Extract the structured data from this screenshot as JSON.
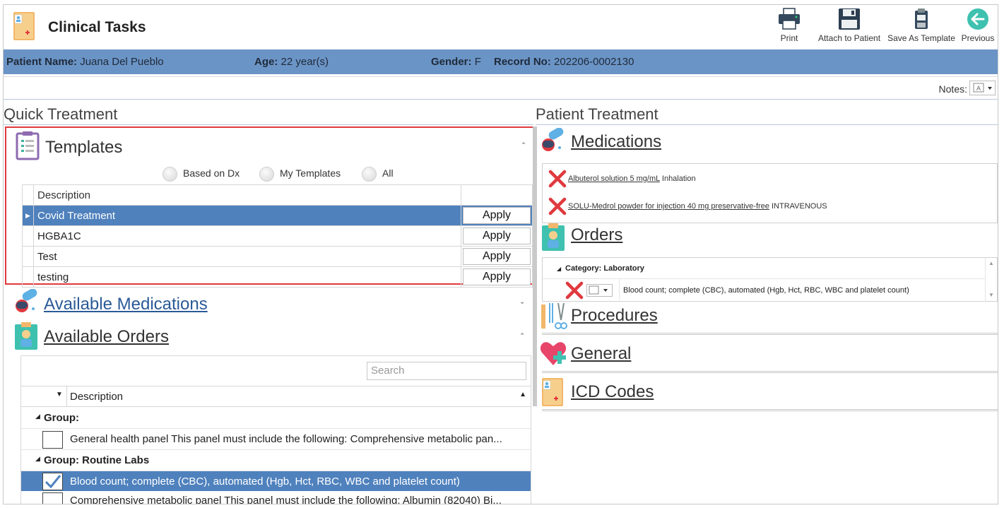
{
  "app": {
    "title": "Clinical Tasks"
  },
  "toolbar": {
    "print": "Print",
    "attach": "Attach to Patient",
    "save_template": "Save As Template",
    "previous": "Previous"
  },
  "patient": {
    "name_label": "Patient Name:",
    "name": "Juana Del Pueblo",
    "age_label": "Age:",
    "age": "22 year(s)",
    "gender_label": "Gender:",
    "gender": "F",
    "record_label": "Record No:",
    "record": "202206-0002130"
  },
  "notes": {
    "label": "Notes:"
  },
  "quick_treatment": {
    "title": "Quick Treatment",
    "templates": {
      "title": "Templates",
      "filters": [
        "Based on Dx",
        "My Templates",
        "All"
      ],
      "column_description": "Description",
      "rows": [
        {
          "description": "Covid Treatment",
          "action": "Apply"
        },
        {
          "description": "HGBA1C",
          "action": "Apply"
        },
        {
          "description": "Test",
          "action": "Apply"
        },
        {
          "description": "testing",
          "action": "Apply"
        }
      ]
    },
    "available_medications": {
      "title": "Available Medications"
    },
    "available_orders": {
      "title": "Available Orders",
      "search_placeholder": "Search",
      "column_description": "Description",
      "groups": [
        {
          "label": "Group:",
          "items": [
            {
              "text": "General health panel This panel must include the following: Comprehensive metabolic pan...",
              "checked": false
            }
          ]
        },
        {
          "label": "Group: Routine Labs",
          "items": [
            {
              "text": "Blood count; complete (CBC), automated (Hgb, Hct, RBC, WBC and platelet count)",
              "checked": true
            },
            {
              "text": "Comprehensive metabolic panel This panel must include the following: Albumin (82040) Bi...",
              "checked": false
            }
          ]
        }
      ]
    }
  },
  "patient_treatment": {
    "title": "Patient Treatment",
    "medications": {
      "title": "Medications",
      "items": [
        {
          "name": "Albuterol solution 5 mg/mL",
          "route": "Inhalation"
        },
        {
          "name": "SOLU-Medrol powder for injection 40 mg preservative-free",
          "route": "INTRAVENOUS"
        }
      ]
    },
    "orders": {
      "title": "Orders",
      "category": "Category: Laboratory",
      "items": [
        {
          "text": "Blood count; complete (CBC), automated (Hgb, Hct, RBC, WBC and platelet count)"
        }
      ]
    },
    "procedures": {
      "title": "Procedures"
    },
    "general": {
      "title": "General"
    },
    "icd_codes": {
      "title": "ICD Codes"
    }
  },
  "colors": {
    "accent": "#4f81bd",
    "patient_bar": "#6b94c6",
    "highlight_border": "#e0393e",
    "link": "#2a5a97",
    "delete": "#e0393e"
  },
  "icons": {
    "app": "clinical-folder-icon",
    "print": "printer-icon",
    "attach": "save-disk-icon",
    "save_template": "clipboard-disk-icon",
    "previous": "arrow-left-circle-icon",
    "templates": "clipboard-list-icon",
    "medications": "pills-icon",
    "orders": "doctor-clipboard-icon",
    "procedures": "surgical-tools-icon",
    "general": "heart-plus-icon",
    "icd_codes": "clinical-folder-icon",
    "delete": "red-x-icon"
  }
}
